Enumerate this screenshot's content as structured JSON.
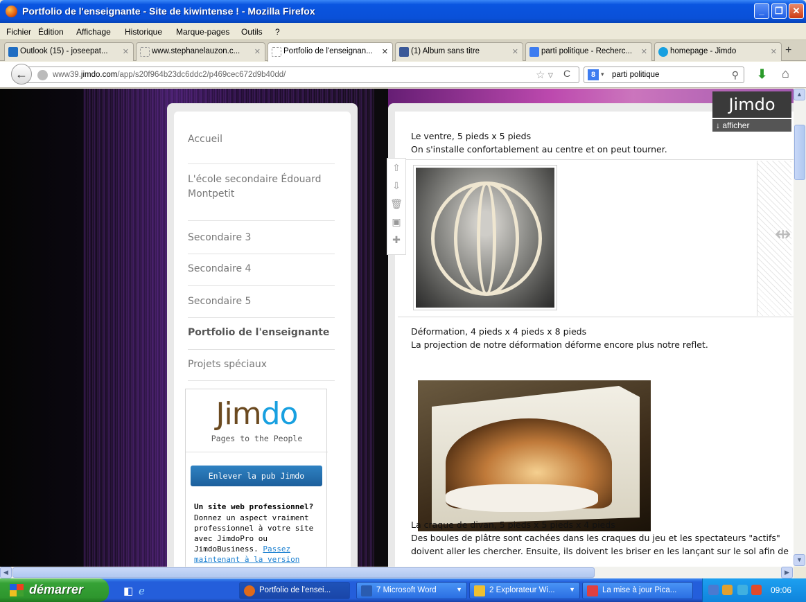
{
  "window": {
    "title": "Portfolio de l'enseignante - Site de kiwintense ! - Mozilla Firefox"
  },
  "menu": [
    "Fichier",
    "Édition",
    "Affichage",
    "Historique",
    "Marque-pages",
    "Outils",
    "?"
  ],
  "tabs": [
    {
      "label": "Outlook (15) - joseepat...",
      "icon_color": "#1f6dc2"
    },
    {
      "label": "www.stephanelauzon.c...",
      "icon_color": "#ffffff"
    },
    {
      "label": "Portfolio de l'enseignan...",
      "icon_color": "#ffffff"
    },
    {
      "label": "(1) Album sans titre",
      "icon_color": "#3b5998"
    },
    {
      "label": "parti politique - Recherc...",
      "icon_color": "#3d7cf0"
    },
    {
      "label": "homepage - Jimdo",
      "icon_color": "#18a0e0"
    }
  ],
  "nav": {
    "url_prefix": "www39.",
    "url_domain": "jimdo.com",
    "url_path": "/app/s20f964b23dc6ddc2/p469cec672d9b40dd/",
    "search_value": "parti politique"
  },
  "sidebar": {
    "items": [
      "Accueil",
      "L'école secondaire Édouard Montpetit",
      "Secondaire 3",
      "Secondaire 4",
      "Secondaire 5",
      "Portfolio de l'enseignante",
      "Projets spéciaux"
    ],
    "active_index": 5
  },
  "ad": {
    "logo_part1": "Jim",
    "logo_part2": "do",
    "tagline": "Pages to the People",
    "button": "Enlever la pub Jimdo",
    "heading": "Un site web professionnel?",
    "body": "Donnez un aspect vraiment professionnel à votre site avec JimdoPro ou JimdoBusiness.",
    "link": "Passez maintenant à la version"
  },
  "content": {
    "item1_title": "Le ventre, 5 pieds x 5 pieds",
    "item1_desc": "On s'installe confortablement au centre et on peut tourner.",
    "item2_title": "Déformation, 4 pieds x 4 pieds x 8 pieds",
    "item2_desc": "La projection de notre déformation déforme encore plus notre reflet.",
    "item3_title": "La craque de divan, 5 pieds x 5 pieds x 4 pieds",
    "item3_desc1": "Des boules de plâtre sont cachées dans les craques du jeu et les spectateurs \"actifs\"",
    "item3_desc2": "doivent aller les chercher. Ensuite, ils doivent les briser en les lançant sur le sol afin de"
  },
  "jimdo_corner": {
    "logo": "Jimdo",
    "toggle": "afficher"
  },
  "taskbar": {
    "start": "démarrer",
    "items": [
      {
        "label": "Portfolio de l'ensei...",
        "icon_color": "#e06a1a"
      },
      {
        "label": "7 Microsoft Word",
        "icon_color": "#2a5cb0"
      },
      {
        "label": "2 Explorateur Wi...",
        "icon_color": "#f0c030"
      },
      {
        "label": "La mise à jour Pica...",
        "icon_color": "#e04040"
      }
    ],
    "clock": "09:06"
  }
}
